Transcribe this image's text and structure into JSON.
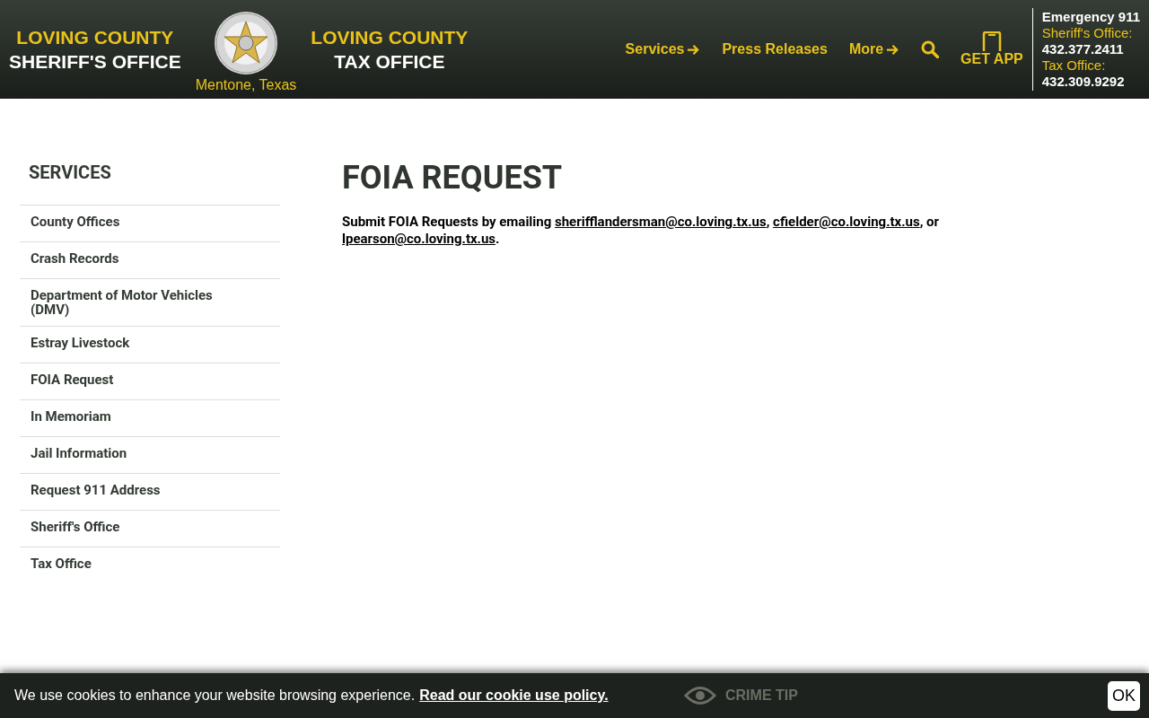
{
  "header": {
    "brand_left": {
      "line1": "LOVING COUNTY",
      "line2": "SHERIFF'S OFFICE"
    },
    "location": "Mentone, Texas",
    "brand_right": {
      "line1": "LOVING COUNTY",
      "line2": "TAX OFFICE"
    },
    "nav": [
      {
        "label": "Services",
        "kind": "arrow"
      },
      {
        "label": "Press Releases",
        "kind": "plain"
      },
      {
        "label": "More",
        "kind": "arrow"
      },
      {
        "kind": "search"
      },
      {
        "label": "GET APP",
        "kind": "app"
      }
    ],
    "contact": {
      "title": "Emergency 911",
      "lines": [
        {
          "label": "Sheriff's Office:",
          "phone": "432.377.2411"
        },
        {
          "label": "Tax Office:",
          "phone": "432.309.9292"
        }
      ]
    }
  },
  "sidebar": {
    "title": "SERVICES",
    "items": [
      {
        "label": "County Offices",
        "selected": false
      },
      {
        "label": "Crash Records",
        "selected": false
      },
      {
        "label": "Department of Motor Vehicles (DMV)",
        "selected": false
      },
      {
        "label": "Estray Livestock",
        "selected": false
      },
      {
        "label": "FOIA Request",
        "selected": false
      },
      {
        "label": "In Memoriam",
        "selected": false
      },
      {
        "label": "Jail Information",
        "selected": false
      },
      {
        "label": "Request 911 Address",
        "selected": false
      },
      {
        "label": "Sheriff's Office",
        "selected": false
      },
      {
        "label": "Tax Office",
        "selected": false
      }
    ]
  },
  "main": {
    "title": "FOIA REQUEST",
    "text_before": "Submit FOIA Requests by emailing ",
    "links": [
      "sherifflandersman@co.loving.tx.us",
      "cfielder@co.loving.tx.us",
      "lpearson@co.loving.tx.us"
    ],
    "separators": [
      ", ",
      ", or ",
      "."
    ]
  },
  "footer": {
    "items": [
      {
        "label": "CRIME TIP"
      }
    ]
  },
  "cookie_bar": {
    "text": "We use cookies to enhance your website browsing experience.",
    "link": "Read our cookie use policy.",
    "button": "OK"
  }
}
